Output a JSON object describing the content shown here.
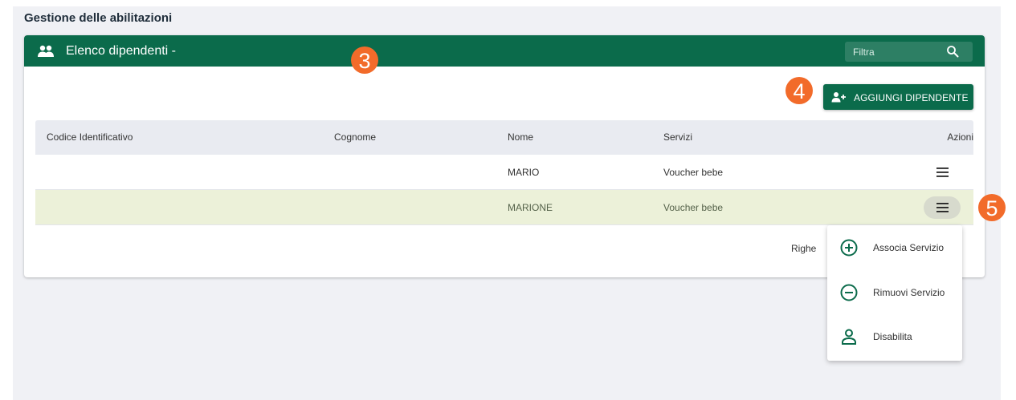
{
  "page": {
    "title": "Gestione delle abilitazioni"
  },
  "card": {
    "title": "Elenco dipendenti -",
    "filter": {
      "placeholder": "Filtra",
      "value": ""
    },
    "add_button_label": "AGGIUNGI DIPENDENTE"
  },
  "table": {
    "headers": [
      "Codice Identificativo",
      "Cognome",
      "Nome",
      "Servizi",
      "Azioni"
    ],
    "rows": [
      {
        "codice": "",
        "cognome": "",
        "nome": "MARIO",
        "servizi": "Voucher bebe"
      },
      {
        "codice": "",
        "cognome": "",
        "nome": "MARIONE",
        "servizi": "Voucher bebe"
      }
    ],
    "footer_label": "Righe"
  },
  "menu": {
    "items": [
      {
        "label": "Associa Servizio",
        "icon": "plus-circle-icon"
      },
      {
        "label": "Rimuovi Servizio",
        "icon": "minus-circle-icon"
      },
      {
        "label": "Disabilita",
        "icon": "person-icon"
      }
    ]
  },
  "markers": [
    "3",
    "4",
    "5"
  ],
  "colors": {
    "primary": "#0b6b4b",
    "highlight_row": "#ecf1d9",
    "marker": "#f26b2a"
  }
}
